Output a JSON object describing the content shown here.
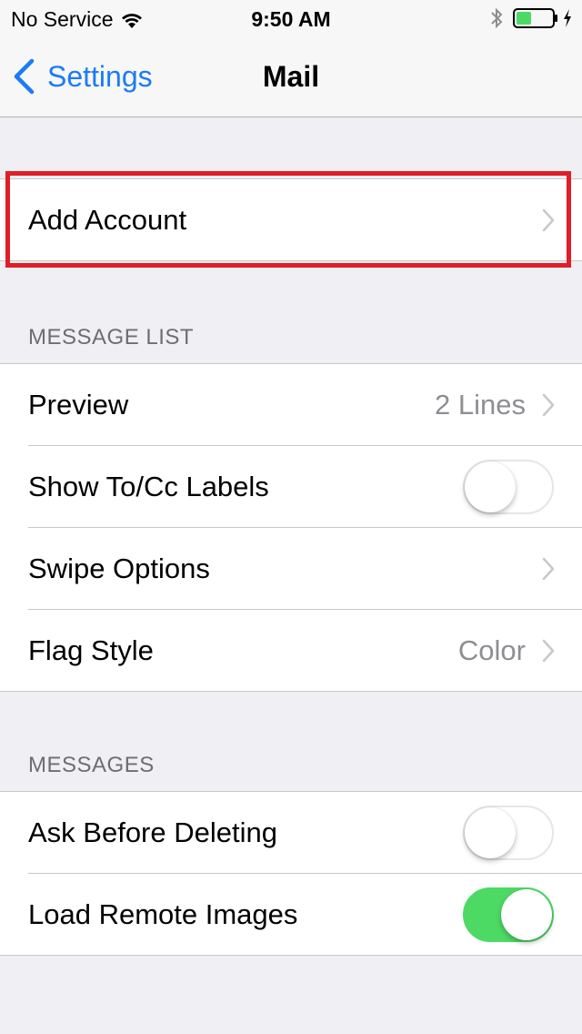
{
  "status_bar": {
    "carrier": "No Service",
    "time": "9:50 AM",
    "battery_color": "#4cd964"
  },
  "nav": {
    "back_label": "Settings",
    "title": "Mail"
  },
  "accounts": {
    "add_account_label": "Add Account"
  },
  "message_list": {
    "header": "MESSAGE LIST",
    "preview_label": "Preview",
    "preview_value": "2 Lines",
    "show_to_cc_label": "Show To/Cc Labels",
    "show_to_cc_on": false,
    "swipe_options_label": "Swipe Options",
    "flag_style_label": "Flag Style",
    "flag_style_value": "Color"
  },
  "messages": {
    "header": "MESSAGES",
    "ask_before_deleting_label": "Ask Before Deleting",
    "ask_before_deleting_on": false,
    "load_remote_images_label": "Load Remote Images",
    "load_remote_images_on": true
  },
  "colors": {
    "accent": "#1a7cf5",
    "toggle_on": "#4cd964",
    "highlight": "#e01e27"
  }
}
